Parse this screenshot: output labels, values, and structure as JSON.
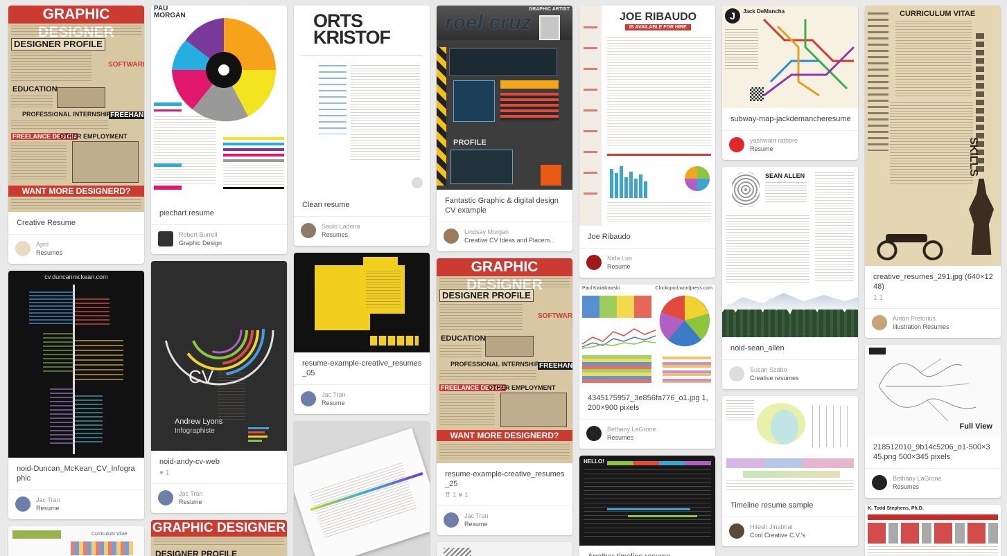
{
  "pins": {
    "creative_resume": {
      "description": "Creative Resume",
      "pinner": "April",
      "board": "Resumes"
    },
    "piechart_resume": {
      "description": "piechart resume",
      "pinner": "Robert Burrell",
      "board": "Graphic Design",
      "thumb_text": {
        "name1": "PAU",
        "name2": "MORGAN"
      }
    },
    "clean_resume": {
      "description": "Clean resume",
      "pinner": "Saulo Ladeira",
      "board": "Resumes",
      "thumb_text": {
        "name1": "ORTS",
        "name2": "KRISTOF"
      }
    },
    "fantastic_graphic": {
      "description": "Fantastic Graphic & digital design CV example",
      "pinner": "Lindsay Morgan",
      "board": "Creative CV Ideas and Placem...",
      "thumb_text": {
        "name": "roel cruz",
        "role": "GRAPHIC ARTIST",
        "profile": "PROFILE"
      }
    },
    "joe_ribaudo": {
      "description": "Joe Ribaudo",
      "pinner": "Nida Luo",
      "board": "Resume",
      "thumb_text": {
        "name": "JOE RIBAUDO",
        "tagline": "IS AVAILABLE FOR HIRE"
      }
    },
    "subway_map": {
      "description": "subway-map-jackdemancheresume",
      "pinner": "yashwant rathore",
      "board": "Resume",
      "thumb_text": {
        "name": "Jack DeMancha",
        "logo": "J"
      }
    },
    "creative_resumes_291": {
      "description": "creative_resumes_291.jpg (640×1248)",
      "stats": "1 1",
      "pinner": "Anton Pretorius",
      "board": "Illustration Resumes",
      "thumb_text": {
        "title": "CURRICULUM VITAE",
        "skills": "SKILLS"
      }
    },
    "duncan_mckean": {
      "description": "noid-Duncan_McKean_CV_Infographic",
      "pinner": "Jac Tran",
      "board": "Resume",
      "thumb_text": {
        "url": "cv.duncanmckean.com"
      }
    },
    "andy_cv_web": {
      "description": "noid-andy-cv-web",
      "stats": "♥ 1",
      "pinner": "Jac Tran",
      "board": "Resume",
      "thumb_text": {
        "cv": "CV",
        "name": "Andrew Lyons",
        "role": "Infographiste"
      }
    },
    "resume_example_05": {
      "description": "resume-example-creative_resumes_05",
      "pinner": "Jac Tran",
      "board": "Resume"
    },
    "resume_example_25": {
      "description": "resume-example-creative_resumes_25",
      "stats": "⇈ 1   ♥ 1",
      "pinner": "Jac Tran",
      "board": "Resume"
    },
    "pixels_1200": {
      "description": "4345175957_3e856fa776_o1.jpg 1,200×900 pixels",
      "pinner": "Bethany LaGrone",
      "board": "Resumes",
      "thumb_text": {
        "name": "Paul Kwiatkowski",
        "site": "Clockopod.wordpress.com"
      }
    },
    "sean_allen": {
      "description": "noid-sean_allen",
      "pinner": "Susan Szabo",
      "board": "Creative resumes",
      "thumb_text": {
        "name": "SEAN ALLEN"
      }
    },
    "pixels_345": {
      "description": "218512010_9b14c5206_o1-500×345.png 500×345 pixels",
      "pinner": "Bethany LaGrone",
      "board": "Resumes",
      "full_view": "Full View"
    },
    "timeline_sample": {
      "description": "Timeline resume sample",
      "pinner": "Hitesh Jinabhai",
      "board": "Cool Creative C.V.'s"
    },
    "another_timeline": {
      "description": "Another timeline resume",
      "thumb_text": {
        "hello": "HELLO!"
      }
    },
    "curriculum_vitae": {
      "thumb_text": {
        "label": "Curriculum Vitae"
      }
    },
    "stephens": {
      "thumb_text": {
        "name": "K. Todd Stephens, Ph.D."
      }
    }
  },
  "retro_poster": {
    "title": "GRAPHIC DESIGNER",
    "profile": "DESIGNER PROFILE",
    "education": "EDUCATION",
    "software": "SOFTWARE",
    "internship": "PROFESSIONAL INTERNSHIP",
    "freehand": "FREEHAND",
    "freelance": "FREELANCE DESIGN",
    "other": "OTHER EMPLOYMENT",
    "want": "WANT MORE DESIGNERD?"
  },
  "colors": {
    "pin_bg": "#ffffff",
    "board_bg": "#e9e9e9",
    "retro_red": "#cc3b32",
    "retro_paper": "#d8c7a3"
  }
}
